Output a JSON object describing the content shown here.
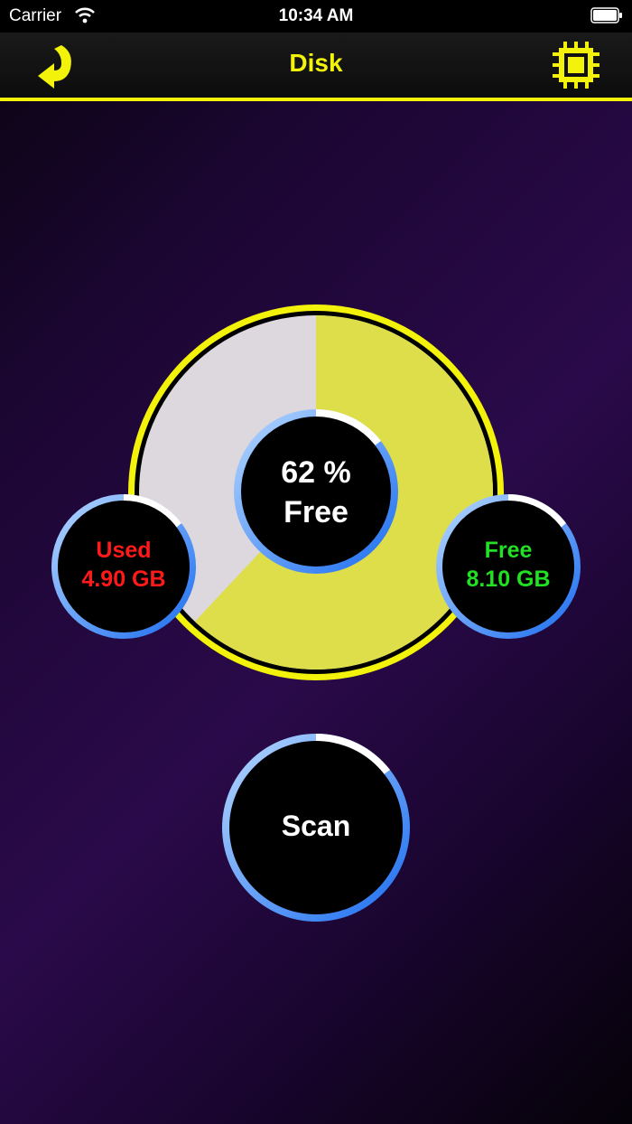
{
  "status_bar": {
    "carrier": "Carrier",
    "time": "10:34 AM"
  },
  "nav": {
    "title": "Disk",
    "back_icon": "curved-arrow-back-icon",
    "chip_icon": "cpu-chip-icon"
  },
  "disk": {
    "free_percent": 62,
    "free_label": "62 %",
    "free_word": "Free",
    "used_label": "Used",
    "used_value": "4.90 GB",
    "free_title": "Free",
    "free_value": "8.10 GB"
  },
  "scan": {
    "label": "Scan"
  },
  "colors": {
    "accent_yellow": "#f2f20a",
    "pie_free": "#dede4a",
    "pie_used": "#dcd8de",
    "used_text": "#ff1a1a",
    "free_text": "#22e022",
    "ring_blue": "#1a6cf0"
  }
}
